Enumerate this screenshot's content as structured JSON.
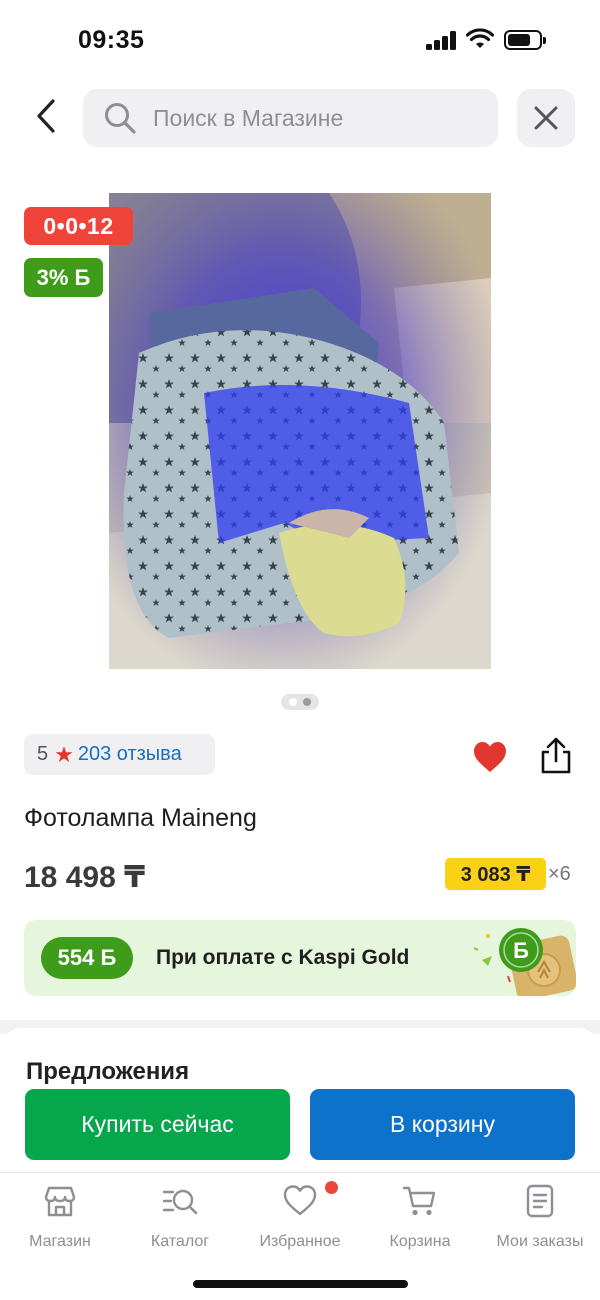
{
  "status_bar": {
    "time": "09:35"
  },
  "search": {
    "placeholder": "Поиск в Магазине"
  },
  "product": {
    "timer_badge": "0•0•12",
    "bonus_badge": "3% Б",
    "rating": "5",
    "reviews_label": "203 отзыва",
    "title": "Фотолампа Maineng",
    "price": "18 498 ₸",
    "installment_price": "3 083 ₸",
    "installment_multiplier": "×6",
    "image_pager": {
      "count": 2,
      "active": 0
    }
  },
  "kaspi_gold": {
    "bonus": "554 Б",
    "text": "При оплате с Kaspi Gold"
  },
  "offers": {
    "title": "Предложения"
  },
  "actions": {
    "buy_now": "Купить сейчас",
    "add_to_cart": "В корзину"
  },
  "tab_bar": {
    "items": [
      {
        "label": "Магазин",
        "icon": "store-icon"
      },
      {
        "label": "Каталог",
        "icon": "catalog-search-icon"
      },
      {
        "label": "Избранное",
        "icon": "heart-outline-icon",
        "has_notification": true
      },
      {
        "label": "Корзина",
        "icon": "cart-icon"
      },
      {
        "label": "Мои заказы",
        "icon": "orders-list-icon"
      }
    ]
  },
  "colors": {
    "red": "#f0433a",
    "green": "#3e9c1a",
    "buy_green": "#06a64c",
    "cart_blue": "#0d72c9",
    "installment_yellow": "#fbd116",
    "link_blue": "#1a6ec2"
  }
}
